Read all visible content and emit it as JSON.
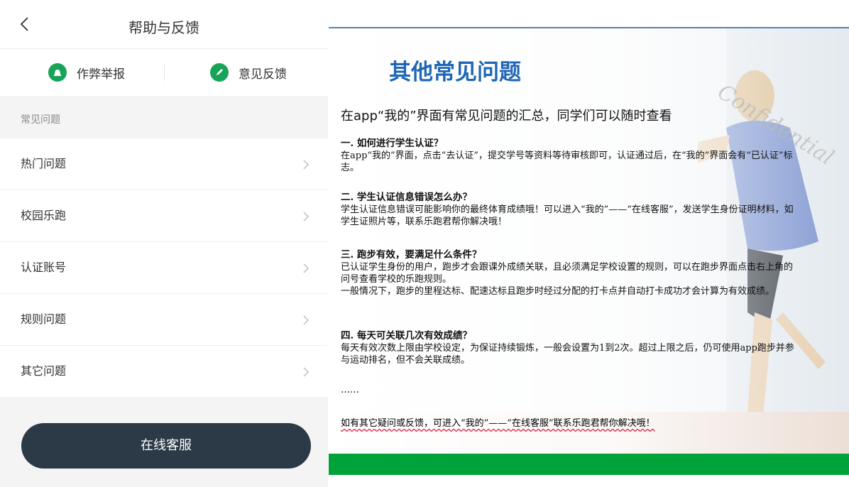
{
  "help": {
    "title": "帮助与反馈",
    "actions": [
      {
        "label": "作弊举报",
        "icon": "alert-bell-icon"
      },
      {
        "label": "意见反馈",
        "icon": "pencil-icon"
      }
    ],
    "section_label": "常见问题",
    "items": [
      {
        "label": "热门问题"
      },
      {
        "label": "校园乐跑"
      },
      {
        "label": "认证账号"
      },
      {
        "label": "规则问题"
      },
      {
        "label": "其它问题"
      }
    ],
    "service_button": "在线客服"
  },
  "slide": {
    "heading": "其他常见问题",
    "watermark": "Confidential",
    "intro": "在app“我的”界面有常见问题的汇总，同学们可以随时查看",
    "qa": [
      {
        "q": "一. 如何进行学生认证？",
        "a": "在app“我的”界面，点击“去认证”，提交学号等资料等待审核即可，认证通过后，在“我的”界面会有“已认证”标志。"
      },
      {
        "q": "二. 学生认证信息错误怎么办？",
        "a": "学生认证信息错误可能影响你的最终体育成绩哦！可以进入“我的”——“在线客服”，发送学生身份证明材料，如学生证照片等，联系乐跑君帮你解决哦！"
      },
      {
        "q": "三. 跑步有效，要满足什么条件？",
        "a": "已认证学生身份的用户，跑步才会跟课外成绩关联，且必须满足学校设置的规则，可以在跑步界面点击右上角的问号查看学校的乐跑规则。",
        "a2": "一般情况下，跑步的里程达标、配速达标且跑步时经过分配的打卡点并自动打卡成功才会计算为有效成绩。"
      },
      {
        "q": "四. 每天可关联几次有效成绩？",
        "a": "每天有效次数上限由学校设定，为保证持续锻炼，一般会设置为1到2次。超过上限之后，仍可使用app跑步并参与运动排名，但不会关联成绩。"
      }
    ],
    "ellipsis": "……",
    "contact": "如有其它疑问或反馈，可进入“我的”——“在线客服”联系乐跑君帮你解决哦！"
  },
  "colors": {
    "accent_green": "#18a358",
    "button_dark": "#2c3a47",
    "heading_blue": "#1f67b6",
    "footer_green": "#00a23a"
  }
}
